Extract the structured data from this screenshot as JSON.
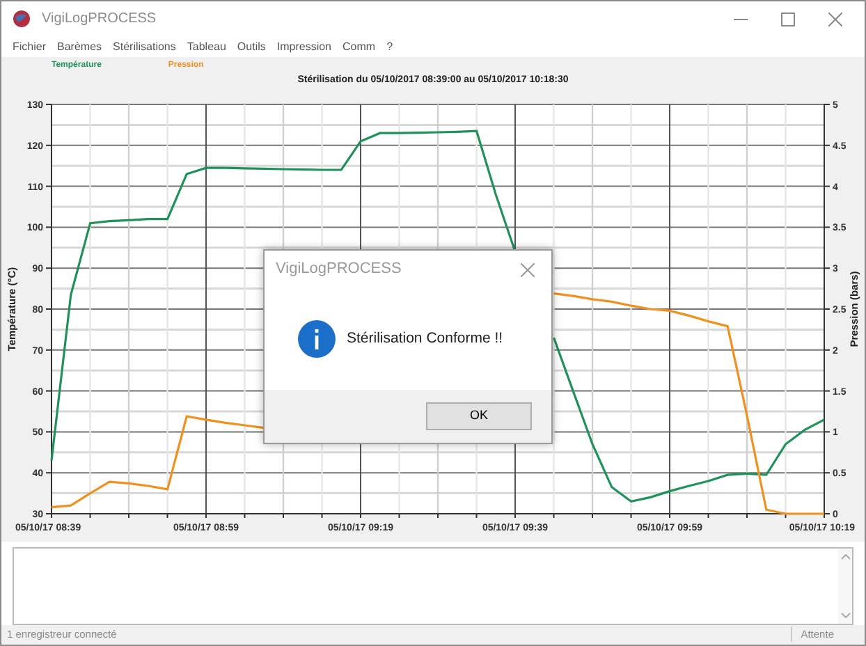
{
  "window": {
    "title": "VigiLogPROCESS"
  },
  "menu": [
    "Fichier",
    "Barèmes",
    "Stérilisations",
    "Tableau",
    "Outils",
    "Impression",
    "Comm",
    "?"
  ],
  "chart_data": {
    "type": "line",
    "title": "Stérilisation du 05/10/2017 08:39:00 au 05/10/2017 10:18:30",
    "ylabel": "Température (°C)",
    "y2label": "Pression (bars)",
    "categories": [
      "05/10/17 08:39",
      null,
      null,
      null,
      null,
      null,
      null,
      null,
      "05/10/17 08:59",
      null,
      null,
      null,
      null,
      null,
      null,
      null,
      "05/10/17 09:19",
      null,
      null,
      null,
      null,
      null,
      null,
      null,
      "05/10/17 09:39",
      null,
      null,
      null,
      null,
      null,
      null,
      null,
      "05/10/17 09:59",
      null,
      null,
      null,
      null,
      null,
      null,
      null,
      "05/10/17 10:19"
    ],
    "series": [
      {
        "name": "Température",
        "color": "#21915a",
        "axis": "y",
        "values": [
          43,
          83.5,
          101,
          101.5,
          101.7,
          102,
          102,
          113,
          114.5,
          114.5,
          114.4,
          114.3,
          114.2,
          114.1,
          114,
          114,
          121,
          123,
          123,
          123.1,
          123.2,
          123.3,
          123.5,
          108,
          94,
          null,
          73,
          60,
          47,
          36.5,
          33,
          34,
          35.5,
          36.8,
          38,
          39.5,
          39.8,
          39.5,
          47,
          50.5,
          53
        ]
      },
      {
        "name": "Pression",
        "color": "#f0901e",
        "axis": "y2",
        "values": [
          0.08,
          0.1,
          0.25,
          0.39,
          0.37,
          0.34,
          0.3,
          1.19,
          1.15,
          1.11,
          1.08,
          1.05,
          null,
          null,
          null,
          null,
          null,
          null,
          null,
          null,
          null,
          null,
          null,
          null,
          null,
          null,
          2.69,
          2.66,
          2.62,
          2.59,
          2.54,
          2.5,
          2.48,
          2.42,
          2.35,
          2.29,
          1.2,
          0.05,
          0,
          0,
          0
        ]
      }
    ],
    "grid": true,
    "ylim": [
      30,
      130
    ],
    "y2lim": [
      0,
      5
    ],
    "yticks": [
      30,
      40,
      50,
      60,
      70,
      80,
      90,
      100,
      110,
      120,
      130
    ],
    "y2ticks": [
      {
        "value": 0,
        "label": "0"
      },
      {
        "value": 0.5,
        "label": "0.5"
      },
      {
        "value": 1,
        "label": "1"
      },
      {
        "value": 1.5,
        "label": "1.5"
      },
      {
        "value": 2,
        "label": "2"
      },
      {
        "value": 2.5,
        "label": "2.5"
      },
      {
        "value": 3,
        "label": "3"
      },
      {
        "value": 3.5,
        "label": "3.5"
      },
      {
        "value": 4,
        "label": "4"
      },
      {
        "value": 4.5,
        "label": "4.5"
      },
      {
        "value": 5,
        "label": "5"
      }
    ]
  },
  "dialog": {
    "title": "VigiLogPROCESS",
    "message": "Stérilisation Conforme !!",
    "button": "OK"
  },
  "status_bar": {
    "text": "1 enregistreur connecté",
    "state": "Attente"
  }
}
